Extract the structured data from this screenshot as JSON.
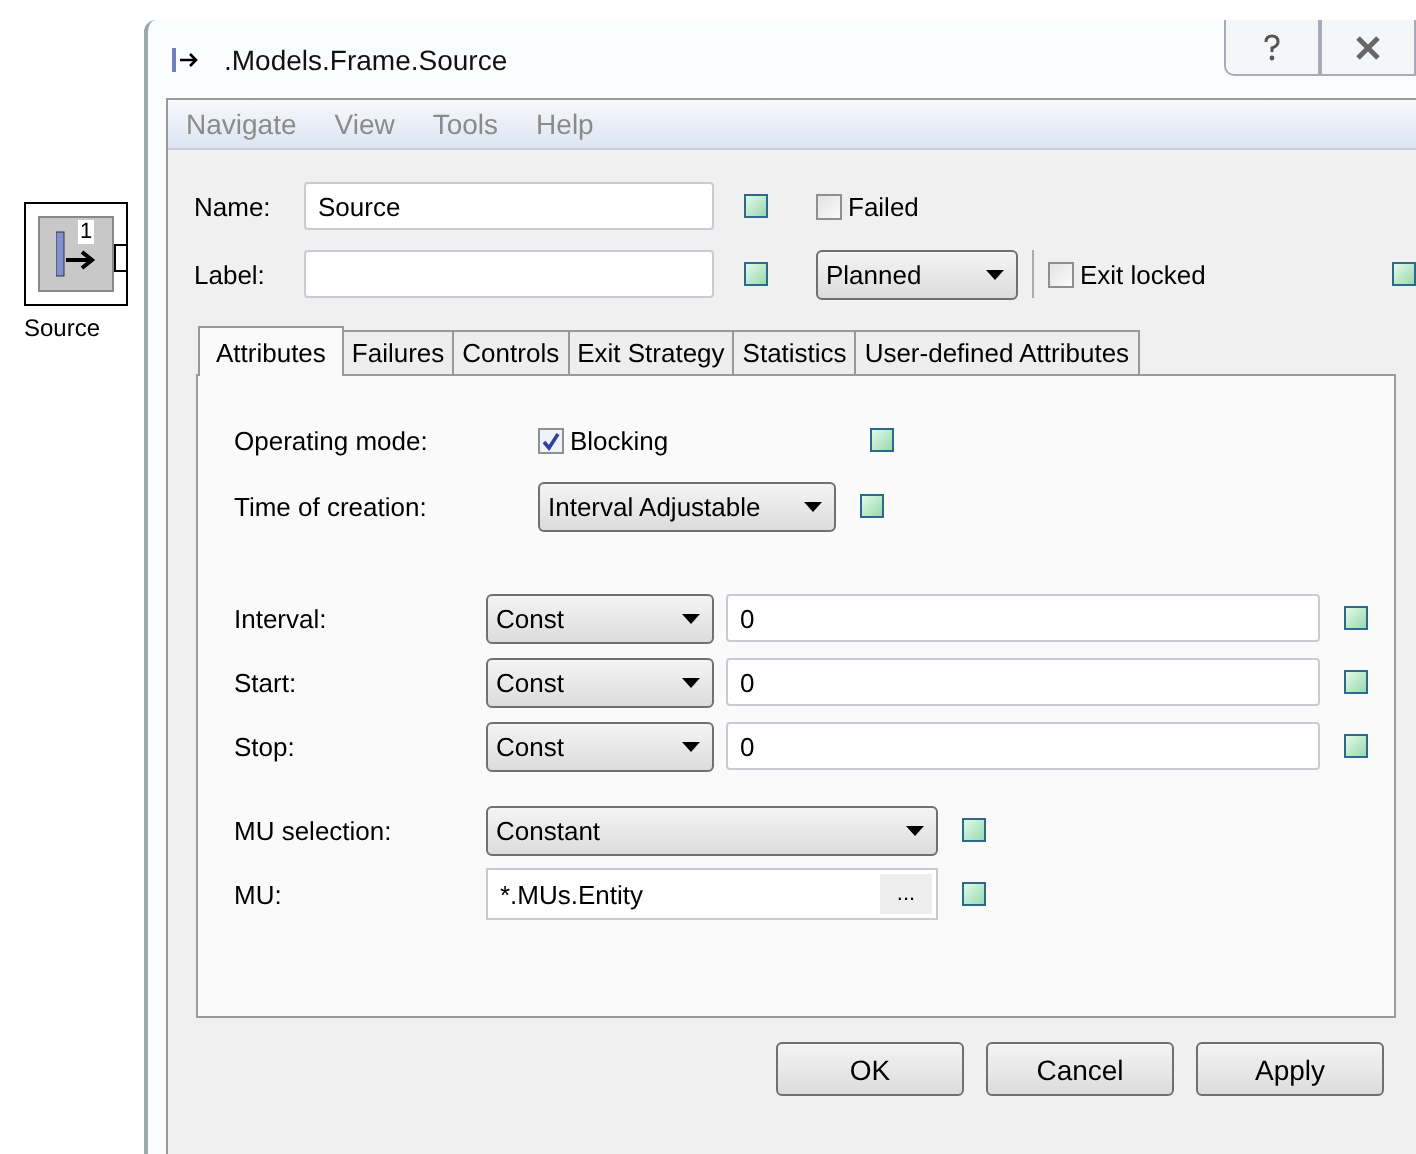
{
  "canvas_object": {
    "badge": "1",
    "label": "Source"
  },
  "window": {
    "title": ".Models.Frame.Source"
  },
  "menu": [
    {
      "label": "Navigate",
      "disabled": true
    },
    {
      "label": "View",
      "disabled": true
    },
    {
      "label": "Tools",
      "disabled": true
    },
    {
      "label": "Help",
      "disabled": true
    }
  ],
  "name_field": {
    "label": "Name:",
    "value": "Source"
  },
  "label_field": {
    "label": "Label:"
  },
  "failed": {
    "label": "Failed",
    "checked": false
  },
  "plan_state": {
    "value": "Planned"
  },
  "exit_locked": {
    "label": "Exit locked",
    "checked": false
  },
  "tabs": [
    {
      "label": "Attributes",
      "selected": true
    },
    {
      "label": "Failures",
      "selected": false
    },
    {
      "label": "Controls",
      "selected": false
    },
    {
      "label": "Exit Strategy",
      "selected": false
    },
    {
      "label": "Statistics",
      "selected": false
    },
    {
      "label": "User-defined Attributes",
      "selected": false
    }
  ],
  "operating_mode": {
    "label": "Operating mode:",
    "option": "Blocking",
    "checked": true
  },
  "time_of_creation": {
    "label": "Time of creation:",
    "value": "Interval Adjustable"
  },
  "timing_rows": [
    {
      "label": "Interval:",
      "distribution": "Const",
      "value": "0"
    },
    {
      "label": "Start:",
      "distribution": "Const",
      "value": "0"
    },
    {
      "label": "Stop:",
      "distribution": "Const",
      "value": "0"
    }
  ],
  "mu_selection": {
    "label": "MU selection:",
    "value": "Constant"
  },
  "mu": {
    "label": "MU:",
    "value": "*.MUs.Entity",
    "button": "..."
  },
  "buttons": [
    "OK",
    "Cancel",
    "Apply"
  ]
}
